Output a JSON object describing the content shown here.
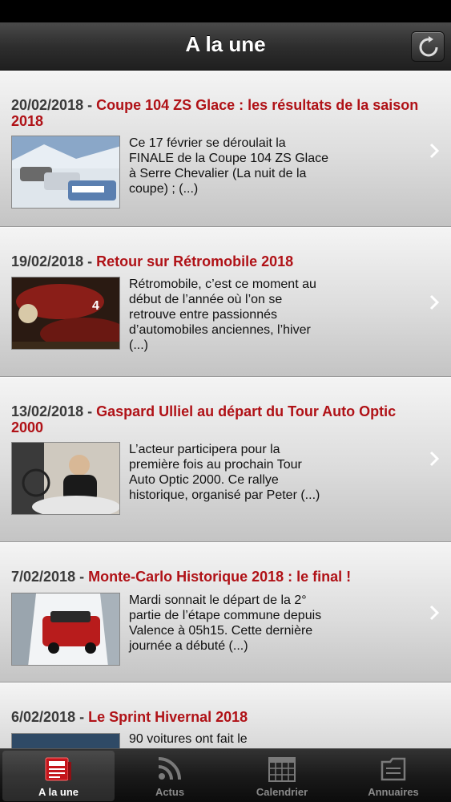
{
  "navbar": {
    "title": "A la une",
    "refresh_icon": "refresh-icon"
  },
  "articles": [
    {
      "date": "20/02/2018",
      "title": "Coupe 104 ZS Glace : les résultats de la saison 2018",
      "summary": "Ce 17 février se déroulait la FINALE de la Coupe 104 ZS Glace à Serre Chevalier (La nuit de la coupe) ; (...)"
    },
    {
      "date": "19/02/2018",
      "title": "Retour sur Rétromobile 2018",
      "summary": "Rétromobile, c’est ce moment au début de l’année où l’on se retrouve entre passionnés d’automobiles anciennes, l’hiver (...)"
    },
    {
      "date": "13/02/2018",
      "title": "Gaspard Ulliel au départ du Tour Auto Optic 2000",
      "summary": "L’acteur participera pour la première fois au prochain Tour Auto Optic 2000. Ce rallye historique, organisé par Peter (...)"
    },
    {
      "date": "7/02/2018",
      "title": "Monte-Carlo Historique 2018 : le final !",
      "summary": "Mardi sonnait le départ de la 2° partie de l’étape commune depuis Valence à 05h15. Cette dernière journée a débuté (...)"
    },
    {
      "date": "6/02/2018",
      "title": "Le Sprint Hivernal 2018",
      "summary": "90 voitures ont fait le"
    }
  ],
  "separator": "-",
  "tabs": [
    {
      "label": "A la une",
      "icon": "newspaper-icon",
      "active": true
    },
    {
      "label": "Actus",
      "icon": "rss-icon",
      "active": false
    },
    {
      "label": "Calendrier",
      "icon": "calendar-icon",
      "active": false
    },
    {
      "label": "Annuaires",
      "icon": "directory-icon",
      "active": false
    }
  ],
  "colors": {
    "accent": "#b01217",
    "navbar": "#2e2e2e",
    "tab_active": "#c4161c"
  }
}
